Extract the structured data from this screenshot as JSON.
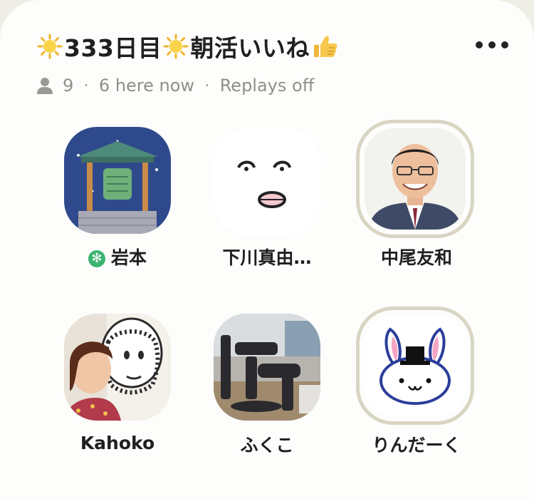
{
  "room": {
    "title": "333日目",
    "title_suffix": "朝活いいね",
    "listener_count": "9",
    "here_now": "6 here now",
    "replays": "Replays off"
  },
  "speakers": [
    {
      "name": "岩本",
      "icon": "temple-bell-avatar",
      "badge": "✻"
    },
    {
      "name": "下川真由…",
      "icon": "face-drawing-avatar"
    },
    {
      "name": "中尾友和",
      "icon": "man-photo-avatar"
    },
    {
      "name": "Kahoko",
      "icon": "woman-photo-avatar"
    },
    {
      "name": "ふくこ",
      "icon": "gym-photo-avatar"
    },
    {
      "name": "りんだーく",
      "icon": "rabbit-avatar"
    }
  ],
  "colors": {
    "card": "#fdfdfc",
    "background": "#efeee6",
    "ring": "#d8d5c3",
    "badge": "#3cb371",
    "muted_text": "#8f8f8a"
  }
}
